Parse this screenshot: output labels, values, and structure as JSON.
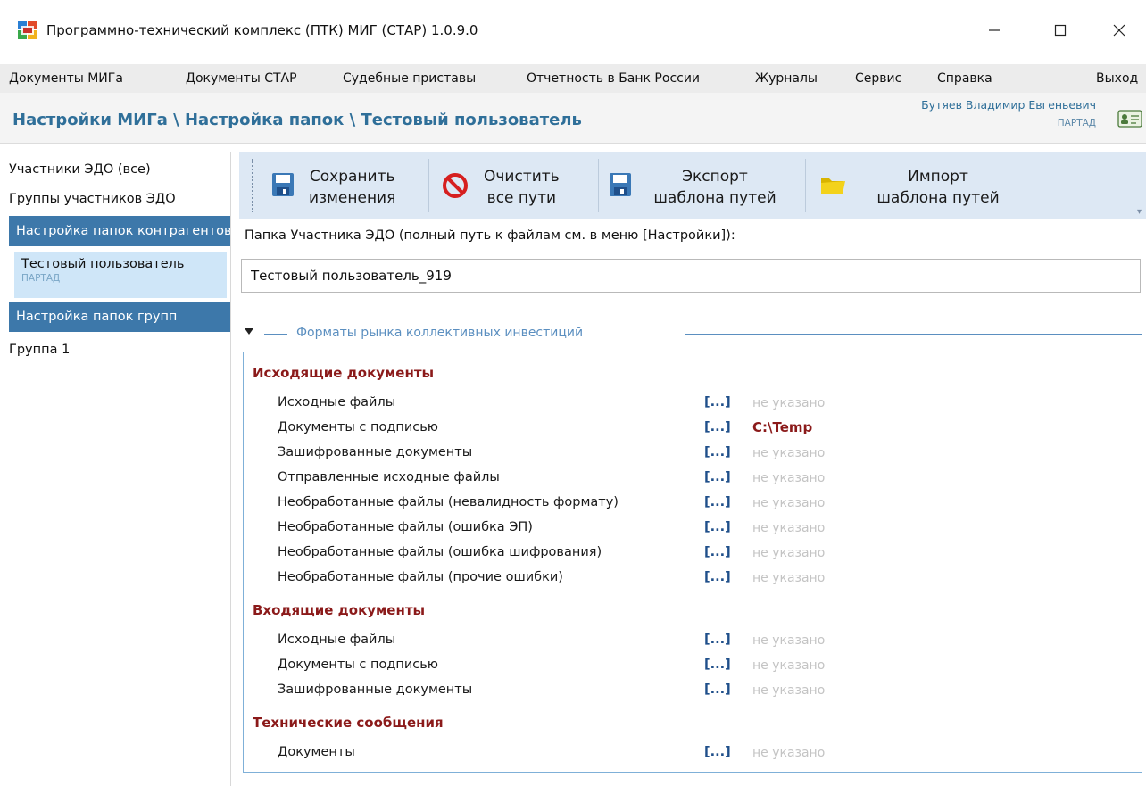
{
  "window": {
    "title": "Программно-технический комплекс (ПТК) МИГ (СТАР) 1.0.9.0",
    "logo_icon": "app-logo-icon",
    "controls": [
      "minimize-icon",
      "maximize-icon",
      "close-icon"
    ]
  },
  "menu": {
    "items": [
      "Документы МИГа",
      "Документы СТАР",
      "Судебные приставы",
      "Отчетность в Банк России",
      "Журналы",
      "Сервис",
      "Справка"
    ],
    "exit_label": "Выход"
  },
  "header": {
    "breadcrumb": "Настройки МИГа \\ Настройка папок \\ Тестовый пользователь",
    "user_name": "Бутяев Владимир Евгеньевич",
    "user_org": "ПАРТАД",
    "user_icon": "user-card-icon"
  },
  "sidebar": {
    "items_top": [
      "Участники ЭДО (все)",
      "Группы участников ЭДО"
    ],
    "section_counterparties": "Настройка папок контрагентов",
    "selected_name": "Тестовый пользователь",
    "selected_org": "ПАРТАД",
    "section_groups": "Настройка папок групп",
    "group_item": "Группа 1"
  },
  "toolbar": {
    "save": {
      "line1": "Сохранить",
      "line2": "изменения",
      "icon": "floppy-disk-icon"
    },
    "clear": {
      "line1": "Очистить",
      "line2": "все пути",
      "icon": "no-entry-icon"
    },
    "export": {
      "line1": "Экспорт",
      "line2": "шаблона путей",
      "icon": "floppy-disk-icon"
    },
    "import": {
      "line1": "Импорт",
      "line2": "шаблона путей",
      "icon": "folder-icon"
    }
  },
  "folder": {
    "label": "Папка Участника ЭДО (полный путь к файлам см. в меню [Настройки]):",
    "value": "Тестовый пользователь_919"
  },
  "group": {
    "title": "Форматы рынка коллективных инвестиций"
  },
  "browse_label": "[...]",
  "sections": [
    {
      "title": "Исходящие документы",
      "rows": [
        {
          "label": "Исходные файлы",
          "path": "не указано",
          "set": false
        },
        {
          "label": "Документы с подписью",
          "path": "C:\\Temp",
          "set": true
        },
        {
          "label": "Зашифрованные документы",
          "path": "не указано",
          "set": false
        },
        {
          "label": "Отправленные исходные файлы",
          "path": "не указано",
          "set": false
        },
        {
          "label": "Необработанные файлы (невалидность формату)",
          "path": "не указано",
          "set": false
        },
        {
          "label": "Необработанные файлы (ошибка ЭП)",
          "path": "не указано",
          "set": false
        },
        {
          "label": "Необработанные файлы (ошибка шифрования)",
          "path": "не указано",
          "set": false
        },
        {
          "label": "Необработанные файлы (прочие ошибки)",
          "path": "не указано",
          "set": false
        }
      ]
    },
    {
      "title": "Входящие документы",
      "rows": [
        {
          "label": "Исходные файлы",
          "path": "не указано",
          "set": false
        },
        {
          "label": "Документы с подписью",
          "path": "не указано",
          "set": false
        },
        {
          "label": "Зашифрованные документы",
          "path": "не указано",
          "set": false
        }
      ]
    },
    {
      "title": "Технические сообщения",
      "rows": [
        {
          "label": "Документы",
          "path": "не указано",
          "set": false
        }
      ]
    }
  ],
  "colors": {
    "accent": "#2f6f99",
    "sidebar_section": "#3d78aa",
    "section_title": "#8b1a1a",
    "path_unset": "#c4c4c4",
    "toolbar_bg": "#dde8f4"
  }
}
